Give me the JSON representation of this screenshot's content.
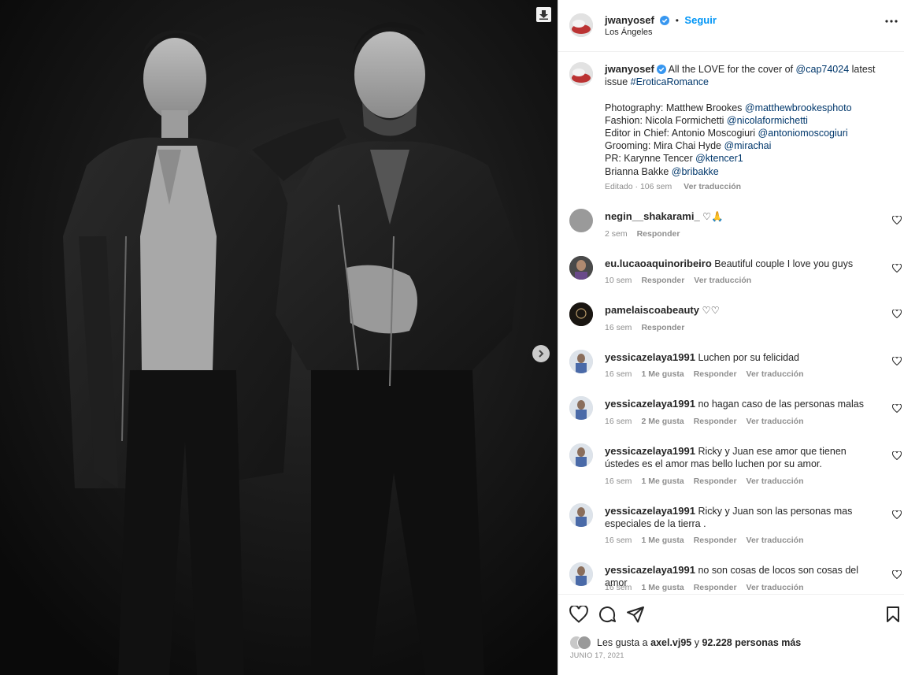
{
  "post": {
    "username": "jwanyosef",
    "follow_label": "Seguir",
    "separator": "•",
    "location": "Los Ángeles"
  },
  "caption": {
    "username": "jwanyosef",
    "line1_pre": "All the LOVE for the cover of ",
    "line1_mention": "@cap74024",
    "line1_post": " latest",
    "line2_pre": "issue ",
    "line2_tag": "#EroticaRomance",
    "credits": [
      {
        "label": "Photography: Matthew Brookes ",
        "handle": "@matthewbrookesphoto"
      },
      {
        "label": "Fashion: Nicola Formichetti ",
        "handle": "@nicolaformichetti"
      },
      {
        "label": "Editor in Chief: Antonio Moscogiuri ",
        "handle": "@antoniomoscogiuri"
      },
      {
        "label": "Grooming: Mira Chai Hyde ",
        "handle": "@mirachai"
      },
      {
        "label": "PR: Karynne Tencer ",
        "handle": "@ktencer1"
      },
      {
        "label": "Brianna Bakke ",
        "handle": "@bribakke"
      }
    ],
    "edited": "Editado · 106 sem",
    "translate": "Ver traducción"
  },
  "comments": [
    {
      "user": "negin__shakarami_",
      "text": "♡🙏",
      "time": "2 sem",
      "likes": "",
      "reply": "Responder",
      "translate": "",
      "avatar": "gray"
    },
    {
      "user": "eu.lucaoaquinoribeiro",
      "text": "Beautiful couple I love you guys",
      "time": "10 sem",
      "likes": "",
      "reply": "Responder",
      "translate": "Ver traducción",
      "avatar": "person"
    },
    {
      "user": "pamelaiscoabeauty",
      "text": "♡♡",
      "time": "16 sem",
      "likes": "",
      "reply": "Responder",
      "translate": "",
      "avatar": "dark"
    },
    {
      "user": "yessicazelaya1991",
      "text": "Luchen por su felicidad",
      "time": "16 sem",
      "likes": "1 Me gusta",
      "reply": "Responder",
      "translate": "Ver traducción",
      "avatar": "blue"
    },
    {
      "user": "yessicazelaya1991",
      "text": "no hagan caso de las personas malas",
      "time": "16 sem",
      "likes": "2 Me gusta",
      "reply": "Responder",
      "translate": "Ver traducción",
      "avatar": "blue"
    },
    {
      "user": "yessicazelaya1991",
      "text": "Ricky y Juan ese amor que tienen ústedes es el amor mas bello luchen por su amor.",
      "time": "16 sem",
      "likes": "1 Me gusta",
      "reply": "Responder",
      "translate": "Ver traducción",
      "avatar": "blue"
    },
    {
      "user": "yessicazelaya1991",
      "text": "Ricky y Juan son las personas mas especiales de la tierra .",
      "time": "16 sem",
      "likes": "1 Me gusta",
      "reply": "Responder",
      "translate": "Ver traducción",
      "avatar": "blue"
    },
    {
      "user": "yessicazelaya1991",
      "text": "no son cosas de locos son cosas del amor",
      "time": "16 sem",
      "likes": "1 Me gusta",
      "reply": "Responder",
      "translate": "Ver traducción",
      "avatar": "blue"
    }
  ],
  "likes_bar": {
    "prefix": "Les gusta a ",
    "user": "axel.vj95",
    "middle": " y ",
    "count": "92.228 personas más",
    "date": "JUNIO 17, 2021"
  },
  "colors": {
    "accent": "#0095f6",
    "link": "#00376b",
    "muted": "#8e8e8e",
    "verified": "#3897f0"
  },
  "icons": {
    "download": "download-icon",
    "next": "chevron-right-icon",
    "more": "more-horizontal-icon",
    "like": "heart-icon",
    "comment": "comment-icon",
    "share": "paper-plane-icon",
    "save": "bookmark-icon"
  }
}
